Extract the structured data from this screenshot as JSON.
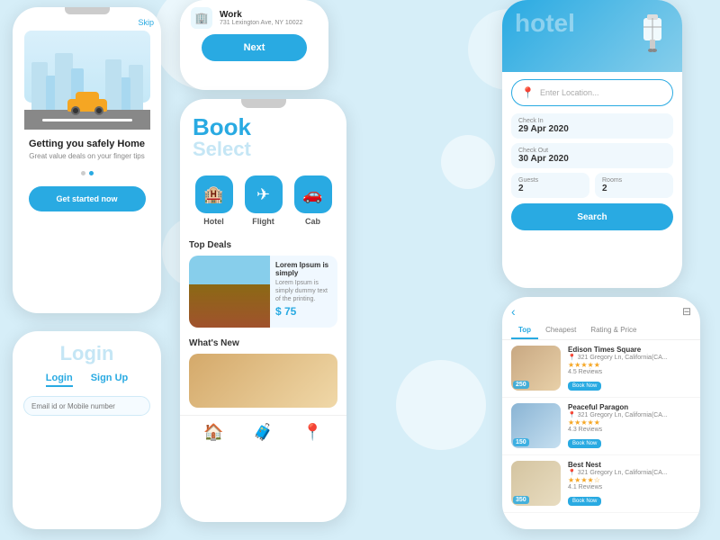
{
  "app": {
    "background": "#d6eef8"
  },
  "phone1": {
    "skip_label": "Skip",
    "title": "Getting you safely Home",
    "subtitle": "Great value deals on your finger tips",
    "get_started_label": "Get started now"
  },
  "phone2": {
    "login_title": "Login",
    "login_tab": "Login",
    "signup_tab": "Sign Up",
    "email_placeholder": "Email id or Mobile number"
  },
  "phone3": {
    "work_label": "Work",
    "work_address": "731 Lexington Ave, NY 10022",
    "next_label": "Next"
  },
  "phone4": {
    "book_title": "Book",
    "book_subtitle": "Select",
    "categories": [
      {
        "label": "Hotel",
        "icon": "🏨"
      },
      {
        "label": "Flight",
        "icon": "✈"
      },
      {
        "label": "Cab",
        "icon": "🚗"
      }
    ],
    "top_deals_label": "Top Deals",
    "deal": {
      "name": "Lorem Ipsum is simply",
      "desc": "Lorem Ipsum is simply dummy text of the printing.",
      "price": "$ 75"
    },
    "whats_new_label": "What's New"
  },
  "phone5": {
    "hotel_title": "Hotel",
    "enter_location_placeholder": "Enter Location...",
    "check_in_label": "Check In",
    "check_in_value": "29 Apr 2020",
    "check_out_label": "Check Out",
    "check_out_value": "30 Apr 2020",
    "guests_label": "Guests",
    "guests_value": "2",
    "rooms_label": "Rooms",
    "rooms_value": "2",
    "search_label": "Search"
  },
  "phone6": {
    "tabs": [
      "Top",
      "Cheapest",
      "Rating & Price"
    ],
    "hotels": [
      {
        "name": "Edison Times Square",
        "location": "321 Gregory Ln, California(CA...",
        "rating": "4.5",
        "reviews": "4.5 Reviews",
        "price": "250",
        "stars": "★★★★★"
      },
      {
        "name": "Peaceful Paragon",
        "location": "321 Gregory Ln, California(CA...",
        "rating": "4.3",
        "reviews": "4.3 Reviews",
        "price": "150",
        "stars": "★★★★★"
      },
      {
        "name": "Best Nest",
        "location": "321 Gregory Ln, California(CA...",
        "rating": "4.1",
        "reviews": "4.1 Reviews",
        "price": "350",
        "stars": "★★★★☆"
      }
    ],
    "book_now_label": "Book Now"
  }
}
